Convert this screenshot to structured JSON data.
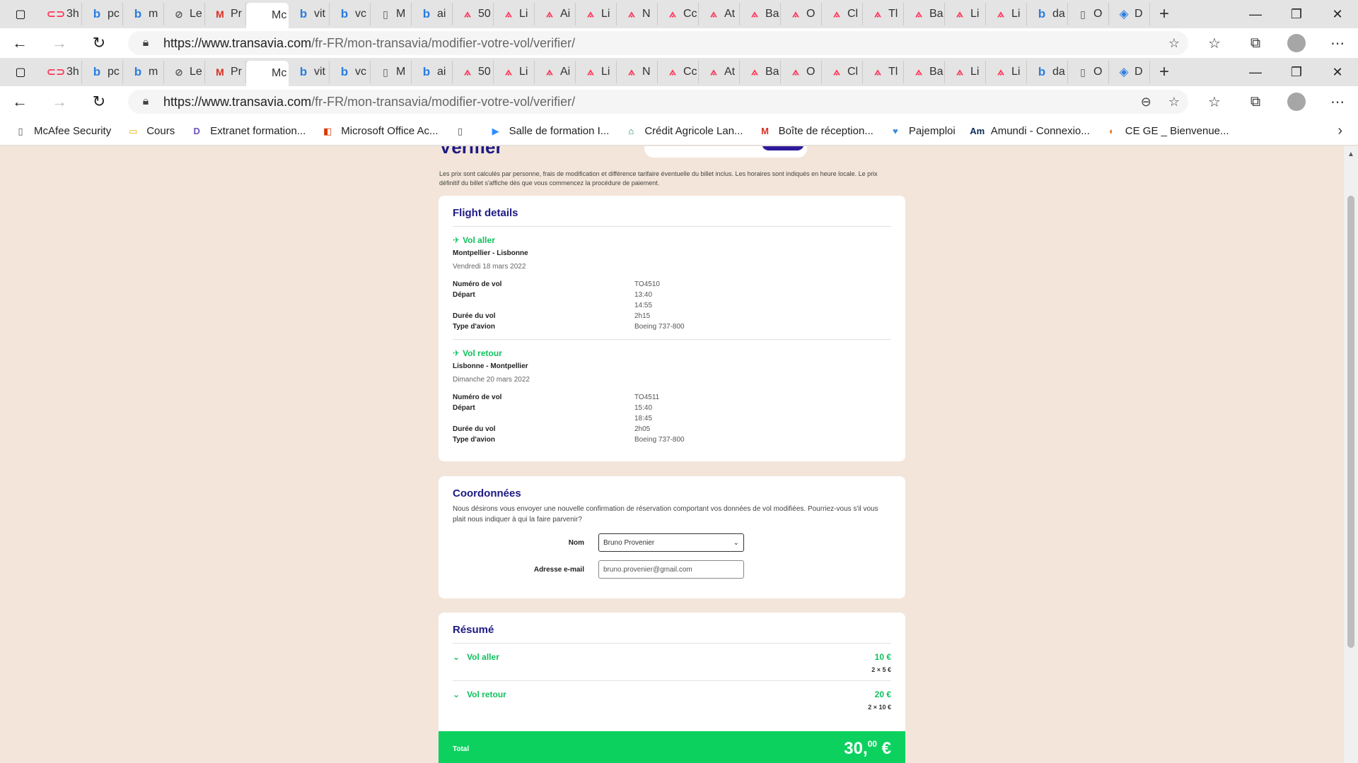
{
  "browser": {
    "tabs": [
      {
        "icon": "link-icon",
        "glyph": "⊂⊃",
        "label": "3h",
        "cls": "air"
      },
      {
        "icon": "bing-icon",
        "glyph": "b",
        "label": "pc",
        "cls": "bing"
      },
      {
        "icon": "bing-icon",
        "glyph": "b",
        "label": "m",
        "cls": "bing"
      },
      {
        "icon": "pattern-icon",
        "glyph": "⊘",
        "label": "Le",
        "cls": "doc"
      },
      {
        "icon": "gmail-icon",
        "glyph": "M",
        "label": "Pr",
        "cls": "gm"
      },
      {
        "icon": "transavia-icon",
        "glyph": "",
        "label": "Mc",
        "cls": "doc",
        "active": true
      },
      {
        "icon": "bing-icon",
        "glyph": "b",
        "label": "vit",
        "cls": "bing"
      },
      {
        "icon": "bing-icon",
        "glyph": "b",
        "label": "vc",
        "cls": "bing"
      },
      {
        "icon": "doc-icon",
        "glyph": "▯",
        "label": "M",
        "cls": "doc"
      },
      {
        "icon": "bing-icon",
        "glyph": "b",
        "label": "ai",
        "cls": "bing"
      },
      {
        "icon": "airbnb-icon",
        "glyph": "⟑",
        "label": "50",
        "cls": "air"
      },
      {
        "icon": "airbnb-icon",
        "glyph": "⟑",
        "label": "Li",
        "cls": "air"
      },
      {
        "icon": "airbnb-icon",
        "glyph": "⟑",
        "label": "Ai",
        "cls": "air"
      },
      {
        "icon": "airbnb-icon",
        "glyph": "⟑",
        "label": "Li",
        "cls": "air"
      },
      {
        "icon": "airbnb-icon",
        "glyph": "⟑",
        "label": "N",
        "cls": "air"
      },
      {
        "icon": "airbnb-icon",
        "glyph": "⟑",
        "label": "Cc",
        "cls": "air"
      },
      {
        "icon": "airbnb-icon",
        "glyph": "⟑",
        "label": "At",
        "cls": "air"
      },
      {
        "icon": "airbnb-icon",
        "glyph": "⟑",
        "label": "Ba",
        "cls": "air"
      },
      {
        "icon": "airbnb-icon",
        "glyph": "⟑",
        "label": "O",
        "cls": "air"
      },
      {
        "icon": "airbnb-icon",
        "glyph": "⟑",
        "label": "Cl",
        "cls": "air"
      },
      {
        "icon": "airbnb-icon",
        "glyph": "⟑",
        "label": "Tl",
        "cls": "air"
      },
      {
        "icon": "airbnb-icon",
        "glyph": "⟑",
        "label": "Ba",
        "cls": "air"
      },
      {
        "icon": "airbnb-icon",
        "glyph": "⟑",
        "label": "Li",
        "cls": "air"
      },
      {
        "icon": "airbnb-icon",
        "glyph": "⟑",
        "label": "Li",
        "cls": "air"
      },
      {
        "icon": "bing-icon",
        "glyph": "b",
        "label": "da",
        "cls": "bing"
      },
      {
        "icon": "doc-icon",
        "glyph": "▯",
        "label": "O",
        "cls": "doc"
      },
      {
        "icon": "map-icon",
        "glyph": "◈",
        "label": "D",
        "cls": "bing"
      }
    ],
    "url_host": "https://www.transavia.com",
    "url_path": "/fr-FR/mon-transavia/modifier-votre-vol/verifier/",
    "bookmarks": [
      {
        "icon": "page-icon",
        "glyph": "▯",
        "label": "McAfee Security",
        "color": "#555"
      },
      {
        "icon": "folder-icon",
        "glyph": "▭",
        "label": "Cours",
        "color": "#e8b400"
      },
      {
        "icon": "extranet-icon",
        "glyph": "D",
        "label": "Extranet formation...",
        "color": "#6b4fbb"
      },
      {
        "icon": "office-icon",
        "glyph": "◧",
        "label": "Microsoft Office Ac...",
        "color": "#d83b01"
      },
      {
        "icon": "page-icon",
        "glyph": "▯",
        "label": "",
        "color": "#555"
      },
      {
        "icon": "video-icon",
        "glyph": "▶",
        "label": "Salle de formation I...",
        "color": "#2d8cff"
      },
      {
        "icon": "bank-icon",
        "glyph": "⌂",
        "label": "Crédit Agricole Lan...",
        "color": "#0b7d6b"
      },
      {
        "icon": "gmail-icon",
        "glyph": "M",
        "label": "Boîte de réception...",
        "color": "#d93025"
      },
      {
        "icon": "heart-icon",
        "glyph": "♥",
        "label": "Pajemploi",
        "color": "#3d8fd9"
      },
      {
        "icon": "amundi-icon",
        "glyph": "Am",
        "label": "Amundi - Connexio...",
        "color": "#0a2a5c"
      },
      {
        "icon": "ce-icon",
        "glyph": "◐",
        "label": "CE GE _ Bienvenue...",
        "color": "#e8731c"
      }
    ]
  },
  "page": {
    "title": "Vérifier",
    "disclaimer": "Les prix sont calculés par personne, frais de modification et différence tarifaire éventuelle du billet inclus. Les horaires sont indiqués en heure locale. Le prix définitif du billet s'affiche dès que vous commencez la procédure de paiement.",
    "flight_details": {
      "heading": "Flight details",
      "legs": [
        {
          "title": "Vol aller",
          "route": "Montpellier - Lisbonne",
          "date": "Vendredi 18 mars 2022",
          "rows": [
            {
              "k": "Numéro de vol",
              "v": "TO4510"
            },
            {
              "k": "Départ",
              "v": "13:40"
            },
            {
              "k": "",
              "v": "14:55"
            },
            {
              "k": "Durée du vol",
              "v": "2h15"
            },
            {
              "k": "Type d'avion",
              "v": "Boeing 737-800"
            }
          ]
        },
        {
          "title": "Vol retour",
          "route": "Lisbonne - Montpellier",
          "date": "Dimanche 20 mars 2022",
          "rows": [
            {
              "k": "Numéro de vol",
              "v": "TO4511"
            },
            {
              "k": "Départ",
              "v": "15:40"
            },
            {
              "k": "",
              "v": "18:45"
            },
            {
              "k": "Durée du vol",
              "v": "2h05"
            },
            {
              "k": "Type d'avion",
              "v": "Boeing 737-800"
            }
          ]
        }
      ]
    },
    "contact": {
      "heading": "Coordonnées",
      "text": "Nous désirons vous envoyer une nouvelle confirmation de réservation comportant vos données de vol modifiées. Pourriez-vous s'il vous plait nous indiquer à qui la faire parvenir?",
      "name_label": "Nom",
      "name_value": "Bruno Provenier",
      "email_label": "Adresse e-mail",
      "email_value": "bruno.provenier@gmail.com"
    },
    "summary": {
      "heading": "Résumé",
      "items": [
        {
          "label": "Vol aller",
          "price": "10 €",
          "detail": "2 × 5 €"
        },
        {
          "label": "Vol retour",
          "price": "20 €",
          "detail": "2 × 10 €"
        }
      ],
      "total_label": "Total",
      "total_value": "30,",
      "total_cents": "00",
      "total_currency": " €"
    }
  },
  "colors": {
    "brand": "#1d1a83",
    "accent_green": "#10c05e",
    "total_bg": "#0dd15f",
    "page_bg": "#f3e5d9"
  }
}
